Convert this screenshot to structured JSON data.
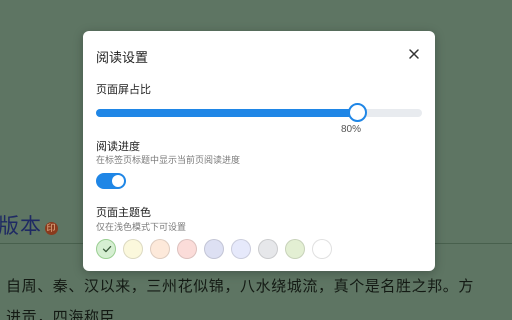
{
  "background": {
    "book_title": "版本",
    "seal_char": "印",
    "line1": "自周、秦、汉以来，三州花似锦，八水绕城流，真个是名胜之邦。方",
    "line2": "进贡，四海称臣"
  },
  "dialog": {
    "title": "阅读设置",
    "close_icon": "close-icon",
    "screen_ratio": {
      "label": "页面屏占比",
      "value": 80,
      "value_text": "80%"
    },
    "reading_progress": {
      "label": "阅读进度",
      "hint": "在标签页标题中显示当前页阅读进度",
      "enabled": true
    },
    "theme": {
      "label": "页面主题色",
      "hint": "仅在浅色模式下可设置",
      "selected_index": 0,
      "check_icon": "check-icon",
      "swatches": [
        "#d6efd2",
        "#fbf8dc",
        "#fde9da",
        "#fbdcd9",
        "#dde0f3",
        "#e6e9fb",
        "#e6e7ea",
        "#e3efd3",
        "#ffffff"
      ]
    }
  },
  "colors": {
    "accent": "#1f86e6",
    "overlay_background": "#5e7563"
  }
}
